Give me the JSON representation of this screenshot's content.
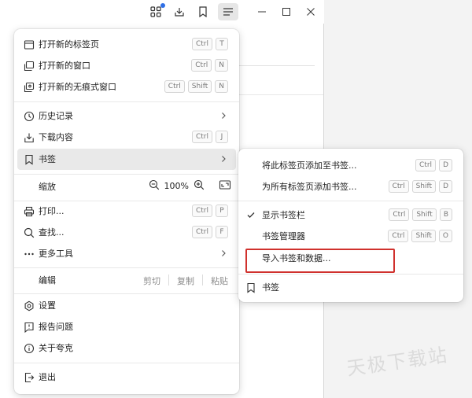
{
  "toolbar": {
    "icons": [
      "apps-icon",
      "download-icon",
      "bookmark-icon",
      "menu-icon",
      "minimize-icon",
      "maximize-icon",
      "close-icon"
    ]
  },
  "menu": {
    "new_tab": {
      "label": "打开新的标签页",
      "keys": [
        "Ctrl",
        "T"
      ]
    },
    "new_window": {
      "label": "打开新的窗口",
      "keys": [
        "Ctrl",
        "N"
      ]
    },
    "new_incognito": {
      "label": "打开新的无痕式窗口",
      "keys": [
        "Ctrl",
        "Shift",
        "N"
      ]
    },
    "history": {
      "label": "历史记录"
    },
    "downloads": {
      "label": "下载内容",
      "keys": [
        "Ctrl",
        "J"
      ]
    },
    "bookmarks": {
      "label": "书签"
    },
    "zoom": {
      "label": "缩放",
      "value": "100%"
    },
    "print": {
      "label": "打印...",
      "keys": [
        "Ctrl",
        "P"
      ]
    },
    "find": {
      "label": "查找...",
      "keys": [
        "Ctrl",
        "F"
      ]
    },
    "more_tools": {
      "label": "更多工具"
    },
    "edit": {
      "label": "编辑",
      "cut": "剪切",
      "copy": "复制",
      "paste": "粘贴"
    },
    "settings": {
      "label": "设置"
    },
    "report": {
      "label": "报告问题"
    },
    "about": {
      "label": "关于夸克"
    },
    "exit": {
      "label": "退出"
    }
  },
  "submenu": {
    "add_current": {
      "label": "将此标签页添加至书签...",
      "keys": [
        "Ctrl",
        "D"
      ]
    },
    "add_all": {
      "label": "为所有标签页添加书签...",
      "keys": [
        "Ctrl",
        "Shift",
        "D"
      ]
    },
    "show_bar": {
      "label": "显示书签栏",
      "keys": [
        "Ctrl",
        "Shift",
        "B"
      ],
      "checked": true
    },
    "manager": {
      "label": "书签管理器",
      "keys": [
        "Ctrl",
        "Shift",
        "O"
      ]
    },
    "import": {
      "label": "导入书签和数据..."
    },
    "folder": {
      "label": "书签"
    }
  },
  "watermark": "天极下载站"
}
